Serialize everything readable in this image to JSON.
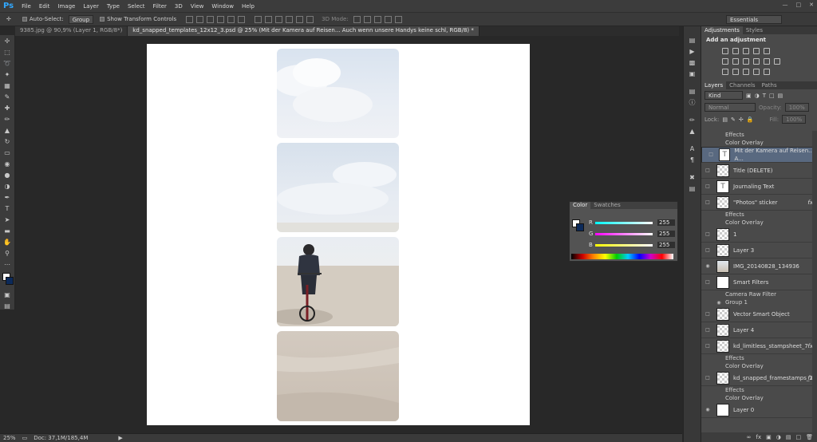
{
  "menu": {
    "logo": "Ps",
    "items": [
      "File",
      "Edit",
      "Image",
      "Layer",
      "Type",
      "Select",
      "Filter",
      "3D",
      "View",
      "Window",
      "Help"
    ]
  },
  "options": {
    "auto_select_label": "Auto-Select:",
    "auto_select_value": "Group",
    "transform_label": "Show Transform Controls",
    "mode3d": "3D Mode:",
    "workspace": "Essentials"
  },
  "tabs": [
    "9385.jpg @ 90,9% (Layer 1, RGB/8*)",
    "kd_snapped_templates_12x12_3.psd @ 25% (Mit der Kamera auf Reisen... Auch wenn unsere Handys keine schl, RGB/8) *"
  ],
  "status": {
    "zoom": "25%",
    "doc": "Doc: 37,1M/185,4M"
  },
  "color_panel": {
    "tabs": [
      "Color",
      "Swatches"
    ],
    "r_label": "R",
    "g_label": "G",
    "b_label": "B",
    "r": "255",
    "g": "255",
    "b": "255"
  },
  "adjust": {
    "tabs": [
      "Adjustments",
      "Styles"
    ],
    "title": "Add an adjustment"
  },
  "layers_panel": {
    "tabs": [
      "Layers",
      "Channels",
      "Paths"
    ],
    "kind": "Kind",
    "blend": "Normal",
    "opacity_label": "Opacity:",
    "opacity": "100%",
    "lock_label": "Lock:",
    "fill_label": "Fill:",
    "fill": "100%"
  },
  "layers": [
    {
      "name": "Effects",
      "sub": true
    },
    {
      "name": "Color Overlay",
      "sub": true
    },
    {
      "name": "Mit der Kamera auf Reisen... A...",
      "thumb": "T",
      "sel": true
    },
    {
      "name": "Title (DELETE)",
      "thumb": "checker"
    },
    {
      "name": "Journaling Text",
      "thumb": "T"
    },
    {
      "name": "\"Photos\" sticker",
      "thumb": "checker",
      "fx": "fx"
    },
    {
      "name": "Effects",
      "sub": true
    },
    {
      "name": "Color Overlay",
      "sub": true
    },
    {
      "name": "1",
      "thumb": "checker"
    },
    {
      "name": "Layer 3",
      "thumb": "checker"
    },
    {
      "name": "IMG_20140828_134936",
      "thumb": "photo",
      "eye": true
    },
    {
      "name": "Smart Filters",
      "thumb": "white"
    },
    {
      "name": "Camera Raw Filter",
      "sub": true
    },
    {
      "name": "Group 1",
      "sub": true,
      "eye": true
    },
    {
      "name": "Vector Smart Object",
      "thumb": "checker"
    },
    {
      "name": "Layer 4",
      "thumb": "checker"
    },
    {
      "name": "kd_limitless_stampsheet_7",
      "thumb": "checker",
      "fx": "fx"
    },
    {
      "name": "Effects",
      "sub": true
    },
    {
      "name": "Color Overlay",
      "sub": true
    },
    {
      "name": "kd_snapped_framestamps_21",
      "thumb": "checker",
      "fx": "fx"
    },
    {
      "name": "Effects",
      "sub": true
    },
    {
      "name": "Color Overlay",
      "sub": true
    },
    {
      "name": "Layer 0",
      "thumb": "white",
      "eye": true
    }
  ]
}
